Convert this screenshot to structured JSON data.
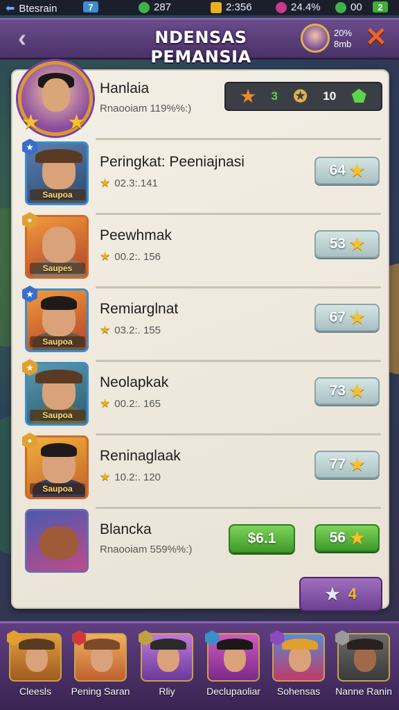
{
  "status_bar": {
    "left_label": "Btesrain",
    "box_value": "7",
    "gem_count": "287",
    "coin_count": "2:356",
    "energy_count": "24.4%",
    "extra_count": "00",
    "level_box": "2"
  },
  "header": {
    "title": "NDENSAS PEMANSIA",
    "stats_line1": "20%",
    "stats_line2": "8mb"
  },
  "profile": {
    "name": "Hanlaia",
    "subtitle": "Rnaooiam 119%%:)",
    "stat_a": "3",
    "stat_b": "10"
  },
  "rows": [
    {
      "name": "Peringkat: Peeniajnasi",
      "sub": "02.3:.141",
      "score": "64",
      "tag": "Saupoa",
      "badge": "★"
    },
    {
      "name": "Peewhmak",
      "sub": "00.2:. 156",
      "score": "53",
      "tag": "Saupes",
      "badge": "●"
    },
    {
      "name": "Remiarglnat",
      "sub": "03.2:. 155",
      "score": "67",
      "tag": "Saupoa",
      "badge": "★"
    },
    {
      "name": "Neolapkak",
      "sub": "00.2:. 165",
      "score": "73",
      "tag": "Saupoa",
      "badge": "★"
    },
    {
      "name": "Reninaglaak",
      "sub": "10.2:. 120",
      "score": "77",
      "tag": "Saupoa",
      "badge": "●"
    }
  ],
  "last_row": {
    "name": "Blancka",
    "sub": "Rnaooiam 559%%:)",
    "price": "$6.1",
    "score": "56"
  },
  "bottom_button": {
    "value": "4"
  },
  "dock": [
    {
      "label": "Cleesls"
    },
    {
      "label": "Pening Saran"
    },
    {
      "label": "Rliy"
    },
    {
      "label": "Declupaoliar"
    },
    {
      "label": "Sohensas"
    },
    {
      "label": "Nanne Ranin"
    }
  ],
  "colors": {
    "header": "#5c3f7c",
    "panel": "#f1ece2",
    "score_button": "#bcd3d4",
    "green_button": "#4fae33",
    "star": "#f5c12a"
  }
}
